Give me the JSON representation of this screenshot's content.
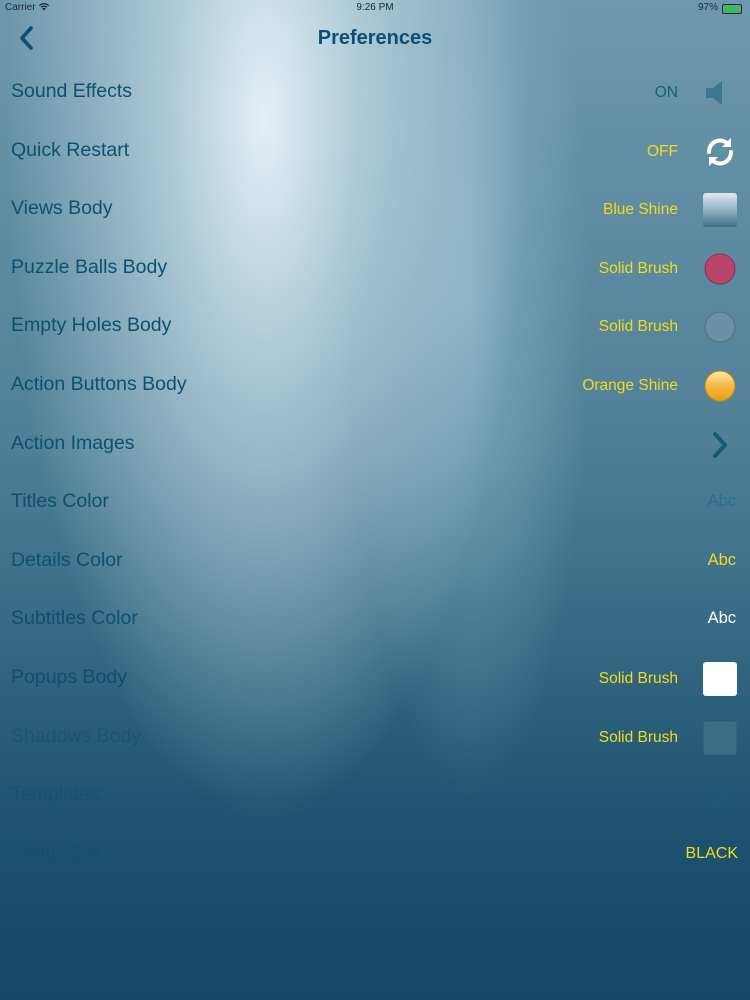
{
  "status_bar": {
    "carrier": "Carrier",
    "time": "9:26 PM",
    "battery": "97%",
    "battery_level": 0.97
  },
  "nav": {
    "title": "Preferences",
    "back_icon": "chevron-left-icon"
  },
  "rows": [
    {
      "label": "Sound Effects",
      "value": "ON",
      "accessory": "speaker-icon"
    },
    {
      "label": "Quick Restart",
      "value": "OFF",
      "accessory": "refresh-icon"
    },
    {
      "label": "Views Body",
      "value": "Blue Shine",
      "accessory": "blue-shine-swatch"
    },
    {
      "label": "Puzzle Balls Body",
      "value": "Solid Brush",
      "accessory": "pink-ball-swatch",
      "color": "#b8446c"
    },
    {
      "label": "Empty Holes Body",
      "value": "Solid Brush",
      "accessory": "gray-blue-ball-swatch",
      "color": "#6b8fa3"
    },
    {
      "label": "Action Buttons Body",
      "value": "Orange Shine",
      "accessory": "orange-ball-swatch",
      "color": "#f5b43a"
    },
    {
      "label": "Action Images",
      "accessory": "chevron-right-icon"
    },
    {
      "label": "Titles Color",
      "sample": "Abc",
      "sample_color": "#2a6e8c"
    },
    {
      "label": "Details Color",
      "sample": "Abc",
      "sample_color": "#f2dc1c"
    },
    {
      "label": "Subtitles Color",
      "sample": "Abc",
      "sample_color": "#ffffff"
    },
    {
      "label": "Popups Body",
      "value": "Solid Brush",
      "accessory": "white-square-swatch",
      "color": "#ffffff"
    },
    {
      "label": "Shadows Body",
      "value": "Solid Brush",
      "accessory": "dark-square-swatch",
      "color": "#3a6f88"
    },
    {
      "label": "Templates",
      "accessory": "chevron-right-icon"
    },
    {
      "label": "Status Bar",
      "value": "BLACK"
    }
  ],
  "colors": {
    "title": "#0d4f72",
    "value": "#f2dc1c",
    "label": "#0f4f6f"
  }
}
